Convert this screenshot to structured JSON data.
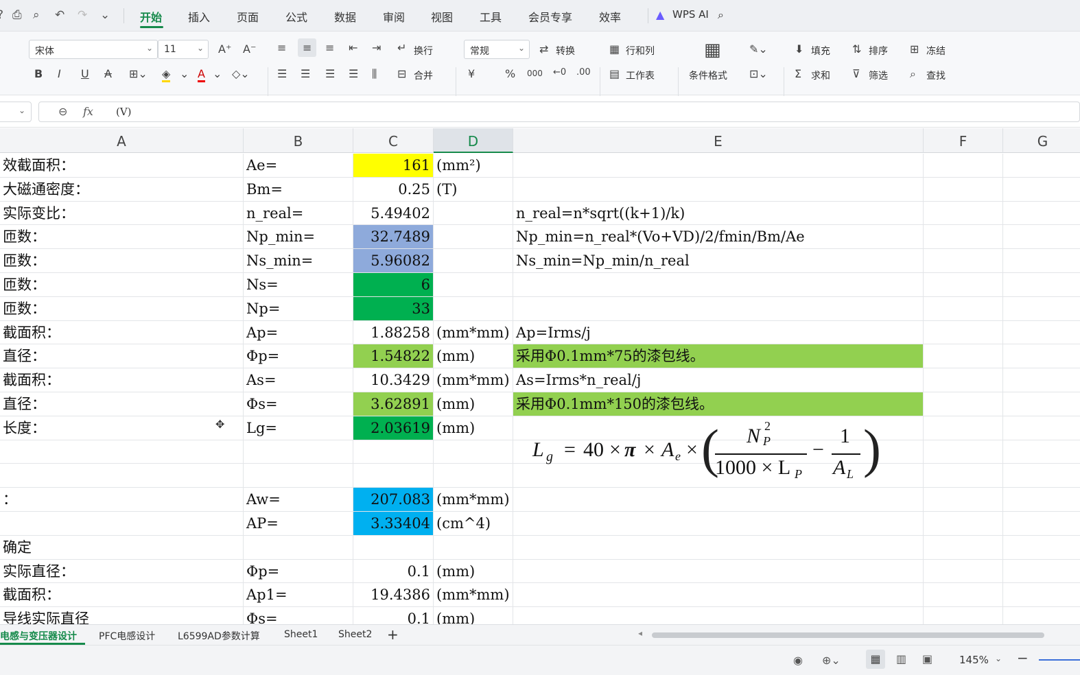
{
  "menubar": {
    "tabs": [
      "开始",
      "插入",
      "页面",
      "公式",
      "数据",
      "审阅",
      "视图",
      "工具",
      "会员专享",
      "效率"
    ],
    "wps_ai": "WPS AI"
  },
  "ribbon": {
    "font_name": "宋体",
    "font_size": "11",
    "wrap_label": "换行",
    "merge_label": "合并",
    "number_format": "常规",
    "convert_label": "转换",
    "rowcol_label": "行和列",
    "worksheet_label": "工作表",
    "condformat_label": "条件格式",
    "fill_label": "填充",
    "sort_label": "排序",
    "freeze_label": "冻结",
    "sum_label": "求和",
    "filter_label": "筛选",
    "find_label": "查找",
    "currency_symbol": "¥",
    "percent_symbol": "%",
    "thousands_symbol": "000"
  },
  "formula_bar": {
    "fx": "fx",
    "content": "(V)"
  },
  "columns": [
    "A",
    "B",
    "C",
    "D",
    "E",
    "F",
    "G"
  ],
  "rows": [
    {
      "a": "效截面积：",
      "b": "Ae=",
      "c": "161",
      "d": "(mm²)",
      "e": "",
      "cfill": "#ffff00",
      "efill": ""
    },
    {
      "a": "大磁通密度：",
      "b": "Bm=",
      "c": "0.25",
      "d": "(T)",
      "e": "",
      "cfill": "",
      "efill": ""
    },
    {
      "a": "实际变比：",
      "b": "n_real=",
      "c": "5.49402",
      "d": "",
      "e": "n_real=n*sqrt((k+1)/k)",
      "cfill": "",
      "efill": ""
    },
    {
      "a": "匝数：",
      "b": "Np_min=",
      "c": "32.7489",
      "d": "",
      "e": "Np_min=n_real*(Vo+VD)/2/fmin/Bm/Ae",
      "cfill": "#8eaadb",
      "efill": ""
    },
    {
      "a": "匝数：",
      "b": "Ns_min=",
      "c": "5.96082",
      "d": "",
      "e": "Ns_min=Np_min/n_real",
      "cfill": "#8eaadb",
      "efill": ""
    },
    {
      "a": "匝数：",
      "b": "Ns=",
      "c": "6",
      "d": "",
      "e": "",
      "cfill": "#00b050",
      "efill": ""
    },
    {
      "a": "匝数：",
      "b": "Np=",
      "c": "33",
      "d": "",
      "e": "",
      "cfill": "#00b050",
      "efill": ""
    },
    {
      "a": "截面积：",
      "b": "Ap=",
      "c": "1.88258",
      "d": "(mm*mm)",
      "e": "Ap=Irms/j",
      "cfill": "",
      "efill": ""
    },
    {
      "a": "直径：",
      "b": "Φp=",
      "c": "1.54822",
      "d": "(mm)",
      "e": "采用Φ0.1mm*75的漆包线。",
      "cfill": "#92d050",
      "efill": "#92d050"
    },
    {
      "a": "截面积：",
      "b": "As=",
      "c": "10.3429",
      "d": "(mm*mm)",
      "e": "As=Irms*n_real/j",
      "cfill": "",
      "efill": ""
    },
    {
      "a": "直径：",
      "b": "Φs=",
      "c": "3.62891",
      "d": "(mm)",
      "e": "采用Φ0.1mm*150的漆包线。",
      "cfill": "#92d050",
      "efill": "#92d050"
    },
    {
      "a": "长度：",
      "b": "Lg=",
      "c": "2.03619",
      "d": "(mm)",
      "e": "",
      "cfill": "#00b050",
      "efill": ""
    },
    {
      "a": "",
      "b": "",
      "c": "",
      "d": "",
      "e": "",
      "cfill": "",
      "efill": ""
    },
    {
      "a": "",
      "b": "",
      "c": "",
      "d": "",
      "e": "",
      "cfill": "",
      "efill": ""
    },
    {
      "a": "：",
      "b": "Aw=",
      "c": "207.083",
      "d": "(mm*mm)",
      "e": "",
      "cfill": "#00b0f0",
      "efill": ""
    },
    {
      "a": "",
      "b": "AP=",
      "c": "3.33404",
      "d": "(cm^4)",
      "e": "",
      "cfill": "#00b0f0",
      "efill": ""
    },
    {
      "a": "确定",
      "b": "",
      "c": "",
      "d": "",
      "e": "",
      "cfill": "",
      "efill": ""
    },
    {
      "a": "实际直径：",
      "b": "Φp=",
      "c": "0.1",
      "d": "(mm)",
      "e": "",
      "cfill": "",
      "efill": ""
    },
    {
      "a": "截面积：",
      "b": "Ap1=",
      "c": "19.4386",
      "d": "(mm*mm)",
      "e": "",
      "cfill": "",
      "efill": ""
    },
    {
      "a": "导线实际直径",
      "b": "Φs=",
      "c": "0.1",
      "d": "(mm)",
      "e": "",
      "cfill": "",
      "efill": ""
    }
  ],
  "formula_image": {
    "lhs": "L",
    "lhs_sub": "g",
    "const": "40",
    "pi": "π",
    "area": "A",
    "area_sub": "e",
    "num1": "N",
    "num1_sub": "P",
    "num1_sup": "2",
    "den1": "1000 × L",
    "den1_sub": "P",
    "num2": "1",
    "den2": "A",
    "den2_sub": "L"
  },
  "sheet_tabs": [
    "电感与变压器设计",
    "PFC电感设计",
    "L6599AD参数计算",
    "Sheet1",
    "Sheet2"
  ],
  "status": {
    "zoom": "145%"
  }
}
